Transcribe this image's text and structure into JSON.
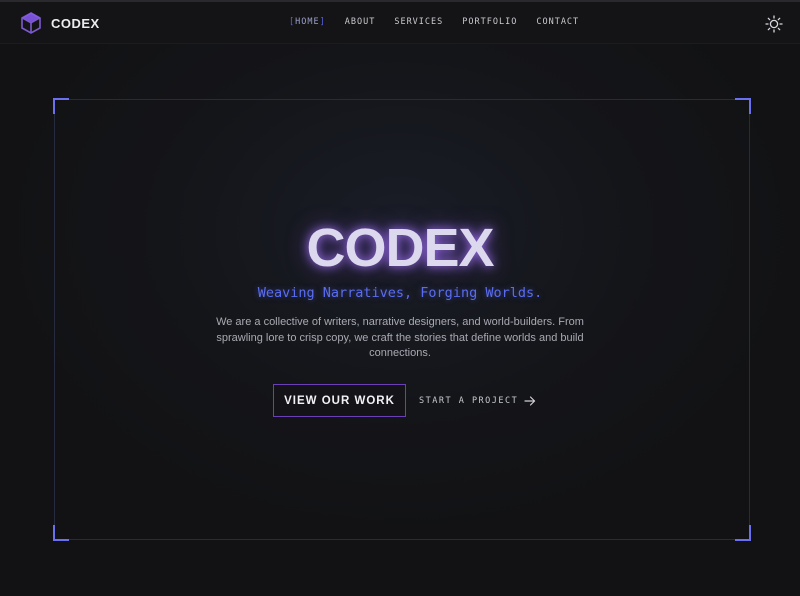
{
  "brand": {
    "name": "CODEX",
    "logo_icon": "cube-icon",
    "accent": "#8b5cf6"
  },
  "nav": {
    "items": [
      {
        "label": "HOME",
        "active": true
      },
      {
        "label": "ABOUT",
        "active": false
      },
      {
        "label": "SERVICES",
        "active": false
      },
      {
        "label": "PORTFOLIO",
        "active": false
      },
      {
        "label": "CONTACT",
        "active": false
      }
    ],
    "active_bracket_open": "[",
    "active_bracket_close": "]"
  },
  "theme_toggle": {
    "icon": "sun-icon"
  },
  "hero": {
    "title": "CODEX",
    "tagline": "Weaving Narratives, Forging Worlds.",
    "description": "We are a collective of writers, narrative designers, and world-builders. From sprawling lore to crisp copy, we craft the stories that define worlds and build connections.",
    "primary_button": "VIEW OUR WORK",
    "secondary_button": "START A PROJECT",
    "secondary_icon": "arrow-right-icon"
  },
  "colors": {
    "background": "#121214",
    "frame_accent": "#6a70f0",
    "tagline": "#5b6cf0",
    "button_border": "#6b3fb8"
  }
}
